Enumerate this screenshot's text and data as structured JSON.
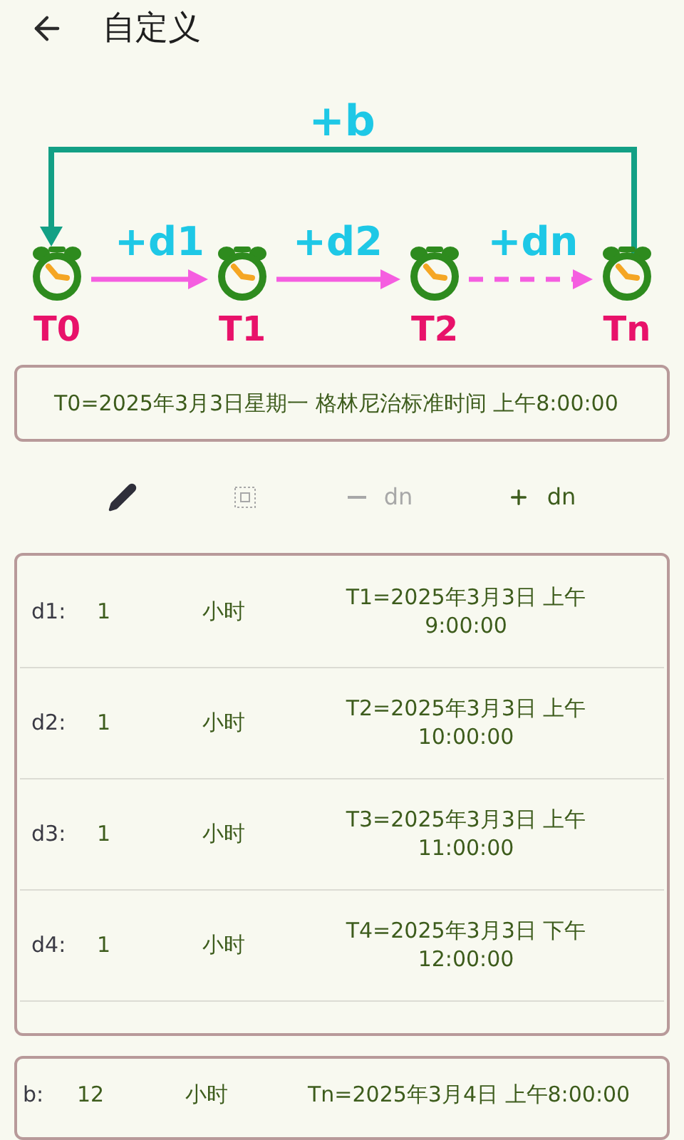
{
  "header": {
    "title": "自定义"
  },
  "diagram": {
    "loop_label": "+b",
    "step_labels": [
      "+d1",
      "+d2",
      "+dn"
    ],
    "nodes": [
      "T0",
      "T1",
      "T2",
      "Tn"
    ]
  },
  "start_time": "T0=2025年3月3日星期一 格林尼治标准时间 上午8:00:00",
  "toolbar": [
    {
      "kind": "edit",
      "disabled": false
    },
    {
      "kind": "select",
      "disabled": true
    },
    {
      "kind": "remove",
      "label": "dn",
      "disabled": true
    },
    {
      "kind": "add",
      "label": "dn",
      "disabled": false
    }
  ],
  "steps": [
    {
      "name": "d1:",
      "value": "1",
      "unit": "小时",
      "result": "T1=2025年3月3日 上午 9:00:00"
    },
    {
      "name": "d2:",
      "value": "1",
      "unit": "小时",
      "result": "T2=2025年3月3日 上午 10:00:00"
    },
    {
      "name": "d3:",
      "value": "1",
      "unit": "小时",
      "result": "T3=2025年3月3日 上午 11:00:00"
    },
    {
      "name": "d4:",
      "value": "1",
      "unit": "小时",
      "result": "T4=2025年3月3日 下午 12:00:00"
    }
  ],
  "back_step": {
    "name": "b:",
    "value": "12",
    "unit": "小时",
    "result": "Tn=2025年3月4日 上午8:00:00"
  }
}
